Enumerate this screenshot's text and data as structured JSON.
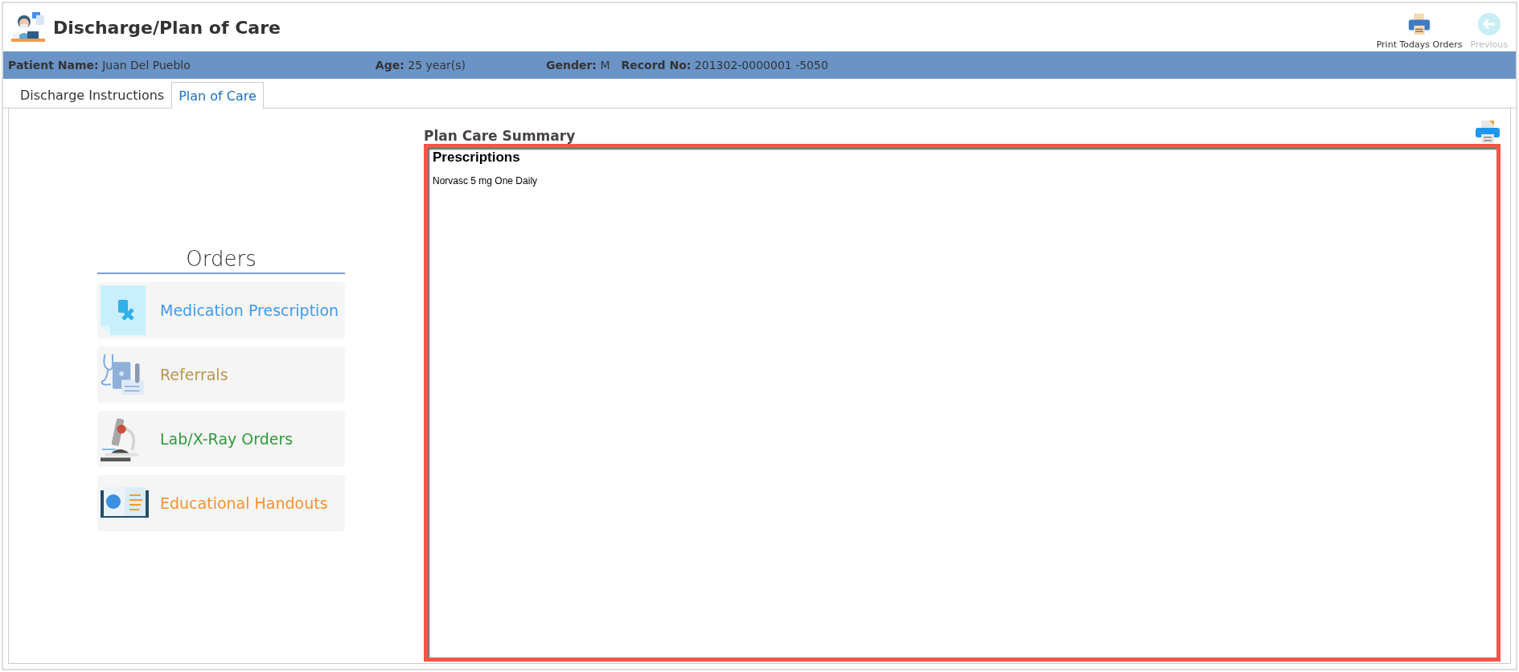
{
  "window": {
    "title": "Discharge/Plan of Care"
  },
  "toolbar": [
    {
      "label": "Print Todays Orders",
      "kind": "print",
      "disabled": false
    },
    {
      "label": "Previous",
      "kind": "back",
      "disabled": true
    }
  ],
  "patient": [
    {
      "label": "Patient Name:",
      "value": "Juan Del Pueblo"
    },
    {
      "label": "Age:",
      "value": "25 year(s)"
    },
    {
      "label": "Gender:",
      "value": "M"
    },
    {
      "label": "Record No:",
      "value": "201302-0000001 -5050"
    }
  ],
  "tabs": [
    {
      "label": "Discharge Instructions",
      "selected": false
    },
    {
      "label": "Plan of Care",
      "selected": true
    }
  ],
  "orders": {
    "title": "Orders",
    "items": [
      {
        "label": "Medication Prescription",
        "kind": "prescription",
        "color": "#3d9af0"
      },
      {
        "label": "Referrals",
        "kind": "referral",
        "color": "#b8964a"
      },
      {
        "label": "Lab/X-Ray Orders",
        "kind": "lab",
        "color": "#2e9a3a"
      },
      {
        "label": "Educational Handouts",
        "kind": "handout",
        "color": "#f7922f"
      }
    ]
  },
  "summary": {
    "title": "Plan Care Summary",
    "sections": [
      {
        "heading": "Prescriptions",
        "lines": [
          "Norvasc 5 mg One Daily"
        ]
      }
    ]
  }
}
